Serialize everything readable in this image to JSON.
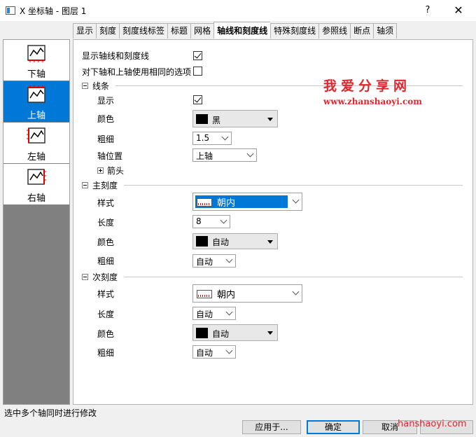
{
  "window": {
    "title": "X 坐标轴 - 图层 1",
    "help": "?",
    "close": "✕"
  },
  "tabs": [
    {
      "label": "显示"
    },
    {
      "label": "刻度"
    },
    {
      "label": "刻度线标签"
    },
    {
      "label": "标题"
    },
    {
      "label": "网格"
    },
    {
      "label": "轴线和刻度线",
      "active": true
    },
    {
      "label": "特殊刻度线"
    },
    {
      "label": "参照线"
    },
    {
      "label": "断点"
    },
    {
      "label": "轴须"
    }
  ],
  "sidebar": {
    "items": [
      {
        "label": "下轴",
        "icon": "bottom-axis-icon"
      },
      {
        "label": "上轴",
        "icon": "top-axis-icon",
        "selected": true
      },
      {
        "label": "左轴",
        "icon": "left-axis-icon"
      },
      {
        "label": "右轴",
        "icon": "right-axis-icon"
      }
    ]
  },
  "options": {
    "show_axis_and_ticks": {
      "label": "显示轴线和刻度线",
      "checked": true
    },
    "same_options": {
      "label": "对下轴和上轴使用相同的选项",
      "checked": false
    }
  },
  "line_section": {
    "title": "线条",
    "show": {
      "label": "显示",
      "checked": true
    },
    "color": {
      "label": "颜色",
      "value": "黑",
      "swatch": "#000000"
    },
    "thickness": {
      "label": "粗细",
      "value": "1.5"
    },
    "position": {
      "label": "轴位置",
      "value": "上轴"
    },
    "arrow": {
      "label": "箭头"
    }
  },
  "major_section": {
    "title": "主刻度",
    "style": {
      "label": "样式",
      "value": "朝内"
    },
    "length": {
      "label": "长度",
      "value": "8"
    },
    "color": {
      "label": "颜色",
      "value": "自动",
      "swatch": "#000000"
    },
    "thickness": {
      "label": "粗细",
      "value": "自动"
    }
  },
  "minor_section": {
    "title": "次刻度",
    "style": {
      "label": "样式",
      "value": "朝内"
    },
    "length": {
      "label": "长度",
      "value": "自动"
    },
    "color": {
      "label": "颜色",
      "value": "自动",
      "swatch": "#000000"
    },
    "thickness": {
      "label": "粗细",
      "value": "自动"
    }
  },
  "watermark": {
    "title": "我爱分享网",
    "url": "www.zhanshaoyi.com",
    "bottom": "hanshaoyi.com"
  },
  "status": "选中多个轴同时进行修改",
  "buttons": {
    "apply": "应用于...",
    "ok": "确定",
    "cancel": "取消"
  },
  "colors": {
    "accent": "#0078d7",
    "watermark": "#e0262d"
  }
}
